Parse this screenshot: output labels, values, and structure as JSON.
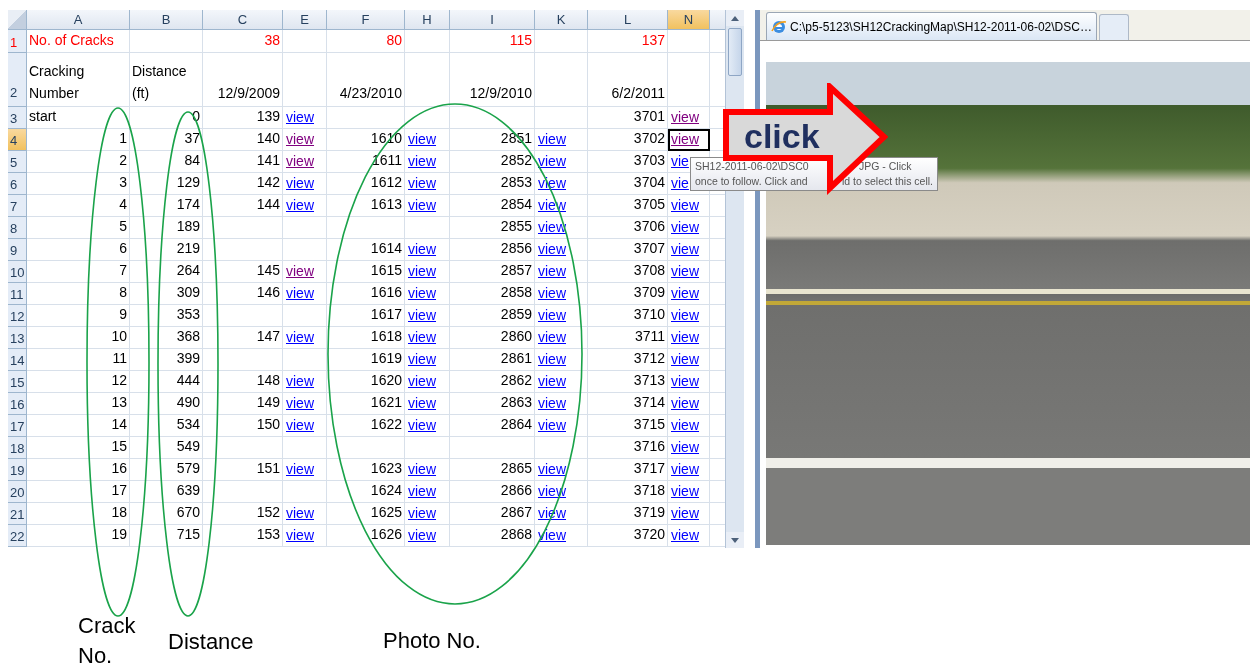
{
  "spreadsheet": {
    "columns": [
      {
        "label": "A",
        "selected": false
      },
      {
        "label": "B",
        "selected": false
      },
      {
        "label": "C",
        "selected": false
      },
      {
        "label": "E",
        "selected": false
      },
      {
        "label": "F",
        "selected": false
      },
      {
        "label": "H",
        "selected": false
      },
      {
        "label": "I",
        "selected": false
      },
      {
        "label": "K",
        "selected": false
      },
      {
        "label": "L",
        "selected": false
      },
      {
        "label": "N",
        "selected": true
      }
    ],
    "rows": [
      {
        "number": "1",
        "kind": "count",
        "selected": false,
        "cells": [
          "No. of Cracks",
          null,
          "38",
          null,
          "80",
          null,
          "115",
          null,
          "137",
          null
        ]
      },
      {
        "number": "2",
        "kind": "header",
        "selected": false,
        "cells": [
          "Cracking\nNumber",
          "Distance\n(ft)",
          "12/9/2009",
          null,
          "4/23/2010",
          null,
          "12/9/2010",
          null,
          "6/2/2011",
          null
        ]
      },
      {
        "number": "3",
        "kind": "data",
        "selected": false,
        "cells": [
          "start",
          "0",
          "139",
          {
            "link": "view",
            "visited": false
          },
          null,
          null,
          null,
          null,
          "3701",
          {
            "link": "view",
            "visited": true
          }
        ]
      },
      {
        "number": "4",
        "kind": "data",
        "selected": true,
        "cells": [
          "1",
          "37",
          "140",
          {
            "link": "view",
            "visited": true
          },
          "1610",
          {
            "link": "view",
            "visited": false
          },
          "2851",
          {
            "link": "view",
            "visited": false
          },
          "3702",
          {
            "link": "view",
            "visited": true,
            "active": true
          }
        ]
      },
      {
        "number": "5",
        "kind": "data",
        "selected": false,
        "cells": [
          "2",
          "84",
          "141",
          {
            "link": "view",
            "visited": true
          },
          "1611",
          {
            "link": "view",
            "visited": false
          },
          "2852",
          {
            "link": "view",
            "visited": false
          },
          "3703",
          {
            "link": "vie",
            "visited": false
          }
        ]
      },
      {
        "number": "6",
        "kind": "data",
        "selected": false,
        "cells": [
          "3",
          "129",
          "142",
          {
            "link": "view",
            "visited": false
          },
          "1612",
          {
            "link": "view",
            "visited": false
          },
          "2853",
          {
            "link": "view",
            "visited": false
          },
          "3704",
          {
            "link": "vie",
            "visited": false
          }
        ]
      },
      {
        "number": "7",
        "kind": "data",
        "selected": false,
        "cells": [
          "4",
          "174",
          "144",
          {
            "link": "view",
            "visited": false
          },
          "1613",
          {
            "link": "view",
            "visited": false
          },
          "2854",
          {
            "link": "view",
            "visited": false
          },
          "3705",
          {
            "link": "view",
            "visited": false
          }
        ]
      },
      {
        "number": "8",
        "kind": "data",
        "selected": false,
        "cells": [
          "5",
          "189",
          null,
          null,
          null,
          null,
          "2855",
          {
            "link": "view",
            "visited": false
          },
          "3706",
          {
            "link": "view",
            "visited": false
          }
        ]
      },
      {
        "number": "9",
        "kind": "data",
        "selected": false,
        "cells": [
          "6",
          "219",
          null,
          null,
          "1614",
          {
            "link": "view",
            "visited": false
          },
          "2856",
          {
            "link": "view",
            "visited": false
          },
          "3707",
          {
            "link": "view",
            "visited": false
          }
        ]
      },
      {
        "number": "10",
        "kind": "data",
        "selected": false,
        "cells": [
          "7",
          "264",
          "145",
          {
            "link": "view",
            "visited": true
          },
          "1615",
          {
            "link": "view",
            "visited": false
          },
          "2857",
          {
            "link": "view",
            "visited": false
          },
          "3708",
          {
            "link": "view",
            "visited": false
          }
        ]
      },
      {
        "number": "11",
        "kind": "data",
        "selected": false,
        "cells": [
          "8",
          "309",
          "146",
          {
            "link": "view",
            "visited": false
          },
          "1616",
          {
            "link": "view",
            "visited": false
          },
          "2858",
          {
            "link": "view",
            "visited": false
          },
          "3709",
          {
            "link": "view",
            "visited": false
          }
        ]
      },
      {
        "number": "12",
        "kind": "data",
        "selected": false,
        "cells": [
          "9",
          "353",
          null,
          null,
          "1617",
          {
            "link": "view",
            "visited": false
          },
          "2859",
          {
            "link": "view",
            "visited": false
          },
          "3710",
          {
            "link": "view",
            "visited": false
          }
        ]
      },
      {
        "number": "13",
        "kind": "data",
        "selected": false,
        "cells": [
          "10",
          "368",
          "147",
          {
            "link": "view",
            "visited": false
          },
          "1618",
          {
            "link": "view",
            "visited": false
          },
          "2860",
          {
            "link": "view",
            "visited": false
          },
          "3711",
          {
            "link": "view",
            "visited": false
          }
        ]
      },
      {
        "number": "14",
        "kind": "data",
        "selected": false,
        "cells": [
          "11",
          "399",
          null,
          null,
          "1619",
          {
            "link": "view",
            "visited": false
          },
          "2861",
          {
            "link": "view",
            "visited": false
          },
          "3712",
          {
            "link": "view",
            "visited": false
          }
        ]
      },
      {
        "number": "15",
        "kind": "data",
        "selected": false,
        "cells": [
          "12",
          "444",
          "148",
          {
            "link": "view",
            "visited": false
          },
          "1620",
          {
            "link": "view",
            "visited": false
          },
          "2862",
          {
            "link": "view",
            "visited": false
          },
          "3713",
          {
            "link": "view",
            "visited": false
          }
        ]
      },
      {
        "number": "16",
        "kind": "data",
        "selected": false,
        "cells": [
          "13",
          "490",
          "149",
          {
            "link": "view",
            "visited": false
          },
          "1621",
          {
            "link": "view",
            "visited": false
          },
          "2863",
          {
            "link": "view",
            "visited": false
          },
          "3714",
          {
            "link": "view",
            "visited": false
          }
        ]
      },
      {
        "number": "17",
        "kind": "data",
        "selected": false,
        "cells": [
          "14",
          "534",
          "150",
          {
            "link": "view",
            "visited": false
          },
          "1622",
          {
            "link": "view",
            "visited": false
          },
          "2864",
          {
            "link": "view",
            "visited": false
          },
          "3715",
          {
            "link": "view",
            "visited": false
          }
        ]
      },
      {
        "number": "18",
        "kind": "data",
        "selected": false,
        "cells": [
          "15",
          "549",
          null,
          null,
          null,
          null,
          null,
          null,
          "3716",
          {
            "link": "view",
            "visited": false
          }
        ]
      },
      {
        "number": "19",
        "kind": "data",
        "selected": false,
        "cells": [
          "16",
          "579",
          "151",
          {
            "link": "view",
            "visited": false
          },
          "1623",
          {
            "link": "view",
            "visited": false
          },
          "2865",
          {
            "link": "view",
            "visited": false
          },
          "3717",
          {
            "link": "view",
            "visited": false
          }
        ]
      },
      {
        "number": "20",
        "kind": "data",
        "selected": false,
        "cells": [
          "17",
          "639",
          null,
          null,
          "1624",
          {
            "link": "view",
            "visited": false
          },
          "2866",
          {
            "link": "view",
            "visited": false
          },
          "3718",
          {
            "link": "view",
            "visited": false
          }
        ]
      },
      {
        "number": "21",
        "kind": "data",
        "selected": false,
        "cells": [
          "18",
          "670",
          "152",
          {
            "link": "view",
            "visited": false
          },
          "1625",
          {
            "link": "view",
            "visited": false
          },
          "2867",
          {
            "link": "view",
            "visited": false
          },
          "3719",
          {
            "link": "view",
            "visited": false
          }
        ]
      },
      {
        "number": "22",
        "kind": "data",
        "selected": false,
        "cells": [
          "19",
          "715",
          "153",
          {
            "link": "view",
            "visited": false
          },
          "1626",
          {
            "link": "view",
            "visited": false
          },
          "2868",
          {
            "link": "view",
            "visited": false
          },
          "3720",
          {
            "link": "view",
            "visited": false
          }
        ]
      }
    ]
  },
  "tooltip": {
    "line_1": [
      "SH12-2011-06-02\\DSC0",
      "JPG - Click"
    ],
    "line_2": [
      "once to follow. Click and",
      "ld to select this cell."
    ]
  },
  "browser": {
    "tab_title": "C:\\p5-5123\\SH12CrackingMap\\SH12-2011-06-02\\DSC…"
  },
  "callout": {
    "label": "click"
  },
  "annotations": [
    {
      "label": "Crack No."
    },
    {
      "label": "Distance"
    },
    {
      "label": "Photo No."
    }
  ]
}
